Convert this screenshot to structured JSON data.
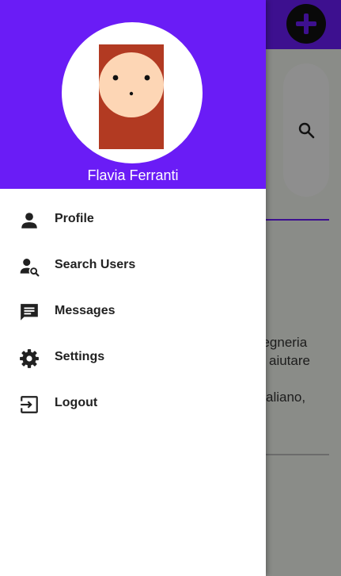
{
  "drawer": {
    "user_name": "Flavia Ferranti",
    "menu": [
      {
        "label": "Profile",
        "icon": "person-icon"
      },
      {
        "label": "Search Users",
        "icon": "person-search-icon"
      },
      {
        "label": "Messages",
        "icon": "message-icon"
      },
      {
        "label": "Settings",
        "icon": "gear-icon"
      },
      {
        "label": "Logout",
        "icon": "logout-icon"
      }
    ]
  },
  "background": {
    "text_lines": [
      "gegneria",
      "aiutare",
      "aliano,"
    ]
  },
  "colors": {
    "primary": "#6a1cf6",
    "drawer_bg": "#ffffff",
    "text": "#212121"
  }
}
